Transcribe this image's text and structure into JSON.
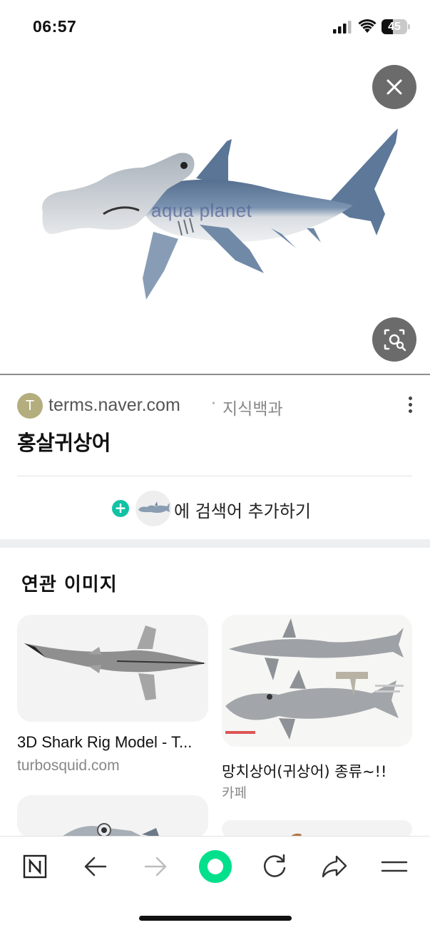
{
  "status_bar": {
    "time": "06:57",
    "battery_level": "45",
    "battery_fraction": 0.45
  },
  "viewer": {
    "watermark": "aqua planet",
    "close_icon": "close-icon",
    "lens_icon": "image-search-lens-icon"
  },
  "result": {
    "source_initial": "T",
    "source_domain": "terms.naver.com",
    "source_separator": "·",
    "source_category": "지식백과",
    "title": "홍살귀상어",
    "add_keyword_label": "에 검색어 추가하기",
    "add_keyword_icon": "plus"
  },
  "related": {
    "section_title": "연관 이미지",
    "items": [
      {
        "title": "3D Shark Rig Model - T...",
        "source": "turbosquid.com"
      },
      {
        "title": "망치상어(귀상어) 종류~!!",
        "source": "카페"
      },
      {
        "title": "",
        "source": ""
      },
      {
        "title": "",
        "source": ""
      }
    ]
  },
  "toolbar": {
    "items": [
      "naver-home-icon",
      "back-arrow-icon",
      "forward-arrow-icon",
      "green-dot-icon",
      "refresh-icon",
      "share-icon",
      "menu-icon"
    ],
    "accent_color": "#03c75a"
  },
  "colors": {
    "teal_plus": "#12c2a4",
    "avatar": "#b4ad7d"
  }
}
